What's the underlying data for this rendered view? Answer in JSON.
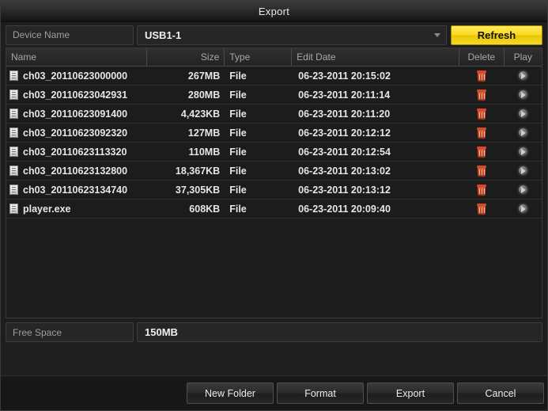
{
  "window": {
    "title": "Export"
  },
  "device": {
    "label": "Device Name",
    "selected": "USB1-1",
    "options": [
      "USB1-1"
    ],
    "refresh_label": "Refresh",
    "dropdown_icon": "chevron-down-icon"
  },
  "table": {
    "columns": [
      "Name",
      "Size",
      "Type",
      "Edit Date",
      "Delete",
      "Play"
    ],
    "rows": [
      {
        "name": "ch03_20110623000000",
        "size": "267MB",
        "type": "File",
        "edit_date": "06-23-2011 20:15:02",
        "delete_icon": "trash-icon",
        "play_icon": "play-icon"
      },
      {
        "name": "ch03_20110623042931",
        "size": "280MB",
        "type": "File",
        "edit_date": "06-23-2011 20:11:14",
        "delete_icon": "trash-icon",
        "play_icon": "play-icon"
      },
      {
        "name": "ch03_20110623091400",
        "size": "4,423KB",
        "type": "File",
        "edit_date": "06-23-2011 20:11:20",
        "delete_icon": "trash-icon",
        "play_icon": "play-icon"
      },
      {
        "name": "ch03_20110623092320",
        "size": "127MB",
        "type": "File",
        "edit_date": "06-23-2011 20:12:12",
        "delete_icon": "trash-icon",
        "play_icon": "play-icon"
      },
      {
        "name": "ch03_20110623113320",
        "size": "110MB",
        "type": "File",
        "edit_date": "06-23-2011 20:12:54",
        "delete_icon": "trash-icon",
        "play_icon": "play-icon"
      },
      {
        "name": "ch03_20110623132800",
        "size": "18,367KB",
        "type": "File",
        "edit_date": "06-23-2011 20:13:02",
        "delete_icon": "trash-icon",
        "play_icon": "play-icon"
      },
      {
        "name": "ch03_20110623134740",
        "size": "37,305KB",
        "type": "File",
        "edit_date": "06-23-2011 20:13:12",
        "delete_icon": "trash-icon",
        "play_icon": "play-icon"
      },
      {
        "name": "player.exe",
        "size": "608KB",
        "type": "File",
        "edit_date": "06-23-2011 20:09:40",
        "delete_icon": "trash-icon",
        "play_icon": "play-icon"
      }
    ]
  },
  "free_space": {
    "label": "Free Space",
    "value": "150MB"
  },
  "footer": {
    "new_folder_label": "New Folder",
    "format_label": "Format",
    "export_label": "Export",
    "cancel_label": "Cancel"
  },
  "colors": {
    "accent_yellow": "#f5d92e",
    "delete_red": "#d04a2a",
    "dialog_bg": "#1e1e1e",
    "table_bg": "#1c1c1c"
  }
}
